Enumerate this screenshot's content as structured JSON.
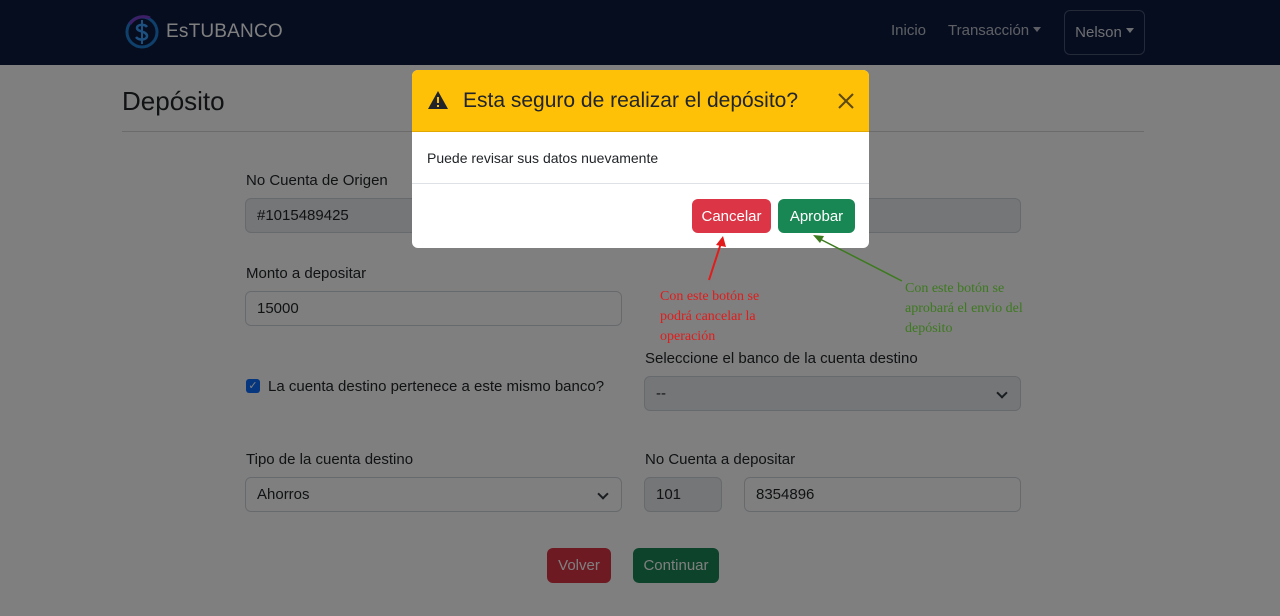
{
  "navbar": {
    "brand": "EsTUBANCO",
    "links": [
      {
        "label": "Inicio"
      },
      {
        "label": "Transacción"
      }
    ],
    "user": "Nelson"
  },
  "page": {
    "title": "Depósito",
    "fields": {
      "origin_label": "No Cuenta de Origen",
      "origin_value": "#1015489425",
      "amount_label": "Monto a depositar",
      "amount_value": "15000",
      "same_bank_label": "La cuenta destino pertenece a este mismo banco?",
      "same_bank_checked": true,
      "bank_label": "Seleccione el banco de la cuenta destino",
      "bank_value": "--",
      "account_type_label": "Tipo de la cuenta destino",
      "account_type_value": "Ahorros",
      "dest_account_label": "No Cuenta a depositar",
      "dest_prefix": "101",
      "dest_number": "8354896"
    },
    "buttons": {
      "back": "Volver",
      "continue": "Continuar"
    }
  },
  "modal": {
    "title": "Esta seguro de realizar el depósito?",
    "body": "Puede revisar sus datos nuevamente",
    "cancel": "Cancelar",
    "approve": "Aprobar"
  },
  "annotations": {
    "cancel_note": "Con este botón se podrá cancelar la operación",
    "approve_note": "Con este botón se aprobará el envio del depósito"
  },
  "colors": {
    "navbar": "#0d1b3f",
    "warning": "#ffc107",
    "danger": "#dc3545",
    "success": "#198754",
    "primary": "#0d6efd",
    "annotation_red": "#e31b1b",
    "annotation_green": "#3d7a1f"
  }
}
